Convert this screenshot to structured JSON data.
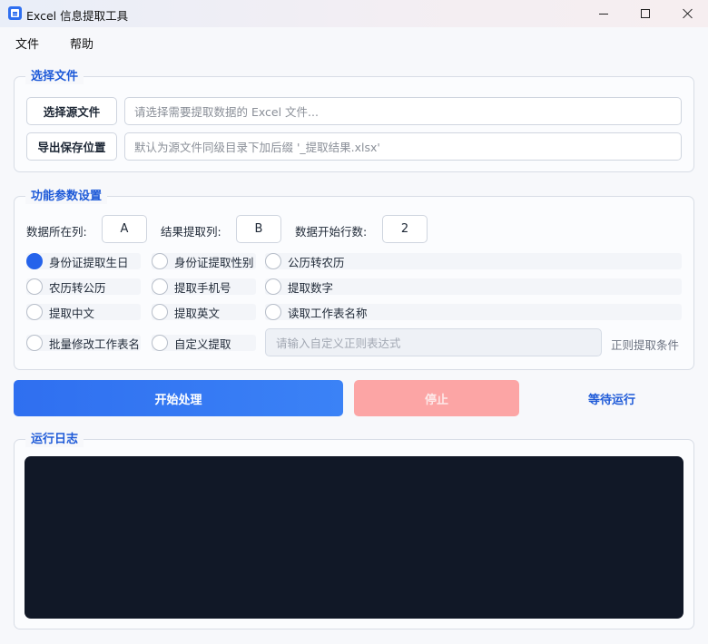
{
  "window": {
    "title": "Excel 信息提取工具"
  },
  "menu": {
    "file": "文件",
    "help": "帮助"
  },
  "file_group": {
    "title": "选择文件",
    "source_button": "选择源文件",
    "source_placeholder": "请选择需要提取数据的 Excel 文件...",
    "export_button": "导出保存位置",
    "export_placeholder": "默认为源文件同级目录下加后缀 '_提取结果.xlsx'"
  },
  "params_group": {
    "title": "功能参数设置",
    "data_column_label": "数据所在列:",
    "data_column_value": "A",
    "result_column_label": "结果提取列:",
    "result_column_value": "B",
    "start_row_label": "数据开始行数:",
    "start_row_value": "2",
    "options": [
      {
        "label": "身份证提取生日",
        "checked": true
      },
      {
        "label": "身份证提取性别",
        "checked": false
      },
      {
        "label": "公历转农历",
        "checked": false
      },
      {
        "label": "农历转公历",
        "checked": false
      },
      {
        "label": "提取手机号",
        "checked": false
      },
      {
        "label": "提取数字",
        "checked": false
      },
      {
        "label": "提取中文",
        "checked": false
      },
      {
        "label": "提取英文",
        "checked": false
      },
      {
        "label": "读取工作表名称",
        "checked": false
      },
      {
        "label": "批量修改工作表名",
        "checked": false
      },
      {
        "label": "自定义提取",
        "checked": false
      }
    ],
    "regex_placeholder": "请输入自定义正则表达式",
    "regex_label": "正则提取条件"
  },
  "actions": {
    "start": "开始处理",
    "stop": "停止",
    "status": "等待运行"
  },
  "log_group": {
    "title": "运行日志",
    "content": ""
  },
  "colors": {
    "accent": "#2563eb",
    "stop_disabled": "#fca5a5",
    "log_background": "#111827"
  }
}
